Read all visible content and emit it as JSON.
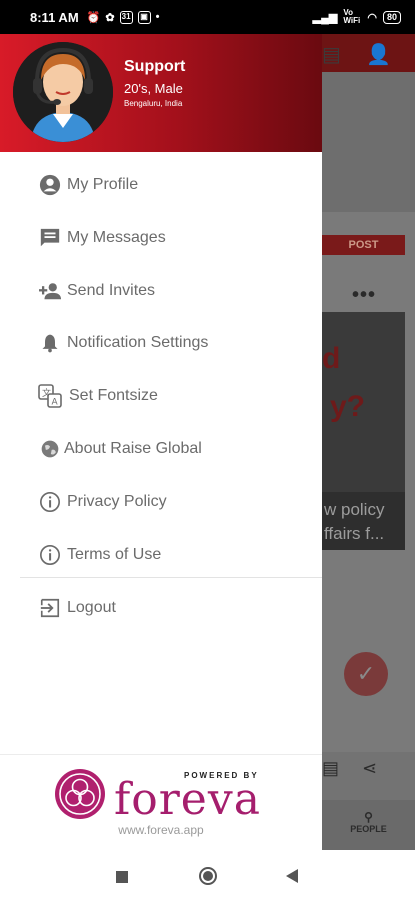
{
  "status_bar": {
    "time": "8:11 AM",
    "signal": "Vo WiFi",
    "battery": "80"
  },
  "profile": {
    "name": "Support",
    "meta": "20's,  Male",
    "location": "Bengaluru, India"
  },
  "menu": {
    "items": [
      {
        "label": "My Profile",
        "icon": "account-circle-icon"
      },
      {
        "label": "My Messages",
        "icon": "message-icon"
      },
      {
        "label": "Send Invites",
        "icon": "person-add-icon"
      },
      {
        "label": "Notification Settings",
        "icon": "bell-icon"
      },
      {
        "label": "Set Fontsize",
        "icon": "translate-icon"
      },
      {
        "label": "About Raise Global",
        "icon": "globe-icon"
      },
      {
        "label": "Privacy Policy",
        "icon": "info-icon"
      },
      {
        "label": "Terms of Use",
        "icon": "info-icon"
      }
    ],
    "logout": {
      "label": "Logout",
      "icon": "logout-icon"
    }
  },
  "footer": {
    "powered_by": "POWERED BY",
    "brand": "foreva",
    "url": "www.foreva.app"
  },
  "background": {
    "post_label": "POST",
    "caption": "w policy\nffairs f...",
    "bottom_tab": "PEOPLE",
    "image_text_1": "d",
    "image_text_2": "y?"
  },
  "colors": {
    "header_start": "#d81b28",
    "header_end": "#6a0a10",
    "brand": "#a51e6d",
    "menu_text": "#6b6b6b"
  }
}
